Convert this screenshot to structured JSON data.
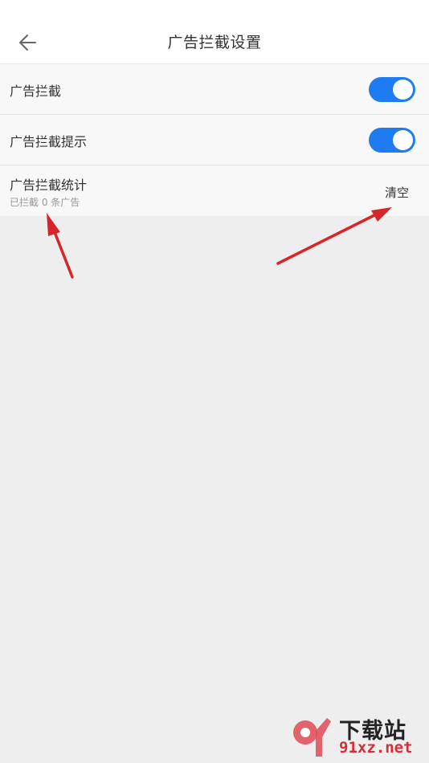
{
  "header": {
    "title": "广告拦截设置",
    "back_icon": "arrow-left-icon"
  },
  "settings": [
    {
      "label": "广告拦截",
      "toggle_on": true
    },
    {
      "label": "广告拦截提示",
      "toggle_on": true
    }
  ],
  "stats": {
    "label": "广告拦截统计",
    "subtitle": "已拦截 0 条广告",
    "clear_label": "清空"
  },
  "colors": {
    "toggle_on": "#1e7cf0",
    "annotation_arrow": "#d7262a",
    "background": "#eeeeee"
  },
  "watermark": {
    "title": "下载站",
    "url": "91xz.net"
  }
}
